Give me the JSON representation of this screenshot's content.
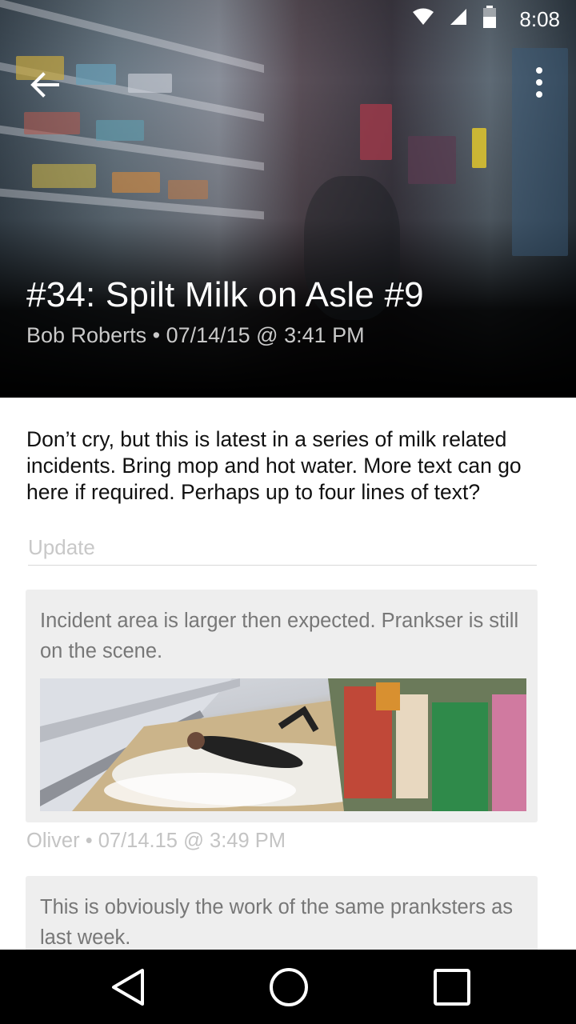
{
  "status_bar": {
    "time": "8:08",
    "icons": [
      "wifi-icon",
      "cell-signal-icon",
      "battery-icon"
    ]
  },
  "header": {
    "title": "#34: Spilt Milk on Asle #9",
    "author": "Bob Roberts",
    "separator": "•",
    "timestamp": "07/14/15 @ 3:41 PM",
    "back_icon": "arrow-back-icon",
    "more_icon": "more-vert-icon"
  },
  "incident": {
    "description": "Don’t cry, but this is latest in a series of milk related incidents. Bring mop and hot water. More text can go here if required. Perhaps up to four lines of text?"
  },
  "update_input": {
    "placeholder": "Update",
    "value": ""
  },
  "updates": [
    {
      "text": "Incident area is larger then expected. Prankser is still on the scene.",
      "author": "Oliver",
      "separator": "•",
      "timestamp": "07/14.15 @ 3:49 PM"
    },
    {
      "text": "This is obviously the work of the same pranksters as last week."
    }
  ],
  "nav_bar": {
    "icons": [
      "nav-back-icon",
      "nav-home-icon",
      "nav-recents-icon"
    ]
  },
  "colors": {
    "card_bg": "#eeeeee",
    "secondary_text": "#777777",
    "meta_text": "#c4c4c4"
  }
}
